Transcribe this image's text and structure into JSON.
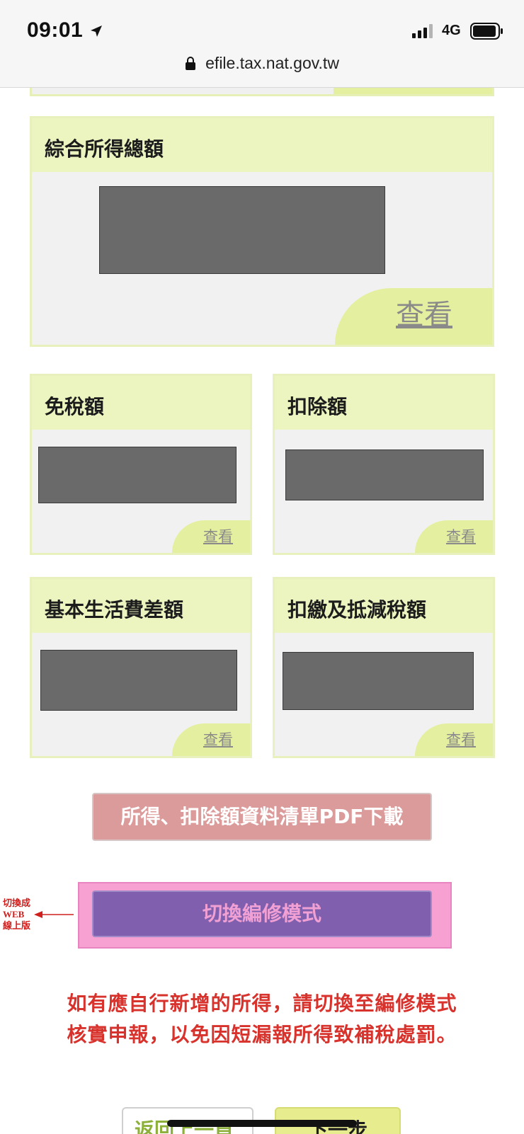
{
  "status_bar": {
    "time": "09:01",
    "network": "4G",
    "url": "efile.tax.nat.gov.tw",
    "icons": [
      "location-arrow-icon",
      "signal-bars-icon",
      "battery-icon",
      "lock-icon"
    ]
  },
  "main_card": {
    "title": "綜合所得總額",
    "view_label": "查看"
  },
  "small_cards": [
    {
      "title": "免稅額",
      "view_label": "查看"
    },
    {
      "title": "扣除額",
      "view_label": "查看"
    },
    {
      "title": "基本生活費差額",
      "view_label": "查看"
    },
    {
      "title": "扣繳及抵減稅額",
      "view_label": "查看"
    }
  ],
  "pdf_button": {
    "label": "所得、扣除額資料清單PDF下載"
  },
  "edit_mode_button": {
    "label": "切換編修模式"
  },
  "annotation": {
    "line1": "切換成",
    "line2": "WEB",
    "line3": "線上版"
  },
  "notice": {
    "line1": "如有應自行新增的所得，請切換至編修模式",
    "line2": "核實申報，以免因短漏報所得致補稅處罰。"
  },
  "nav": {
    "back_label": "返回上一頁",
    "next_label": "下一步"
  },
  "colors": {
    "card_header": "#ecf4c0",
    "view_button": "#e4ef9f",
    "redaction": "#6a6a6a",
    "pdf_button": "#dc9b9b",
    "edit_button": "#7f5fae",
    "highlight": "#f7a1d2",
    "notice_text": "#d8322d",
    "annotation_text": "#d0201e"
  }
}
